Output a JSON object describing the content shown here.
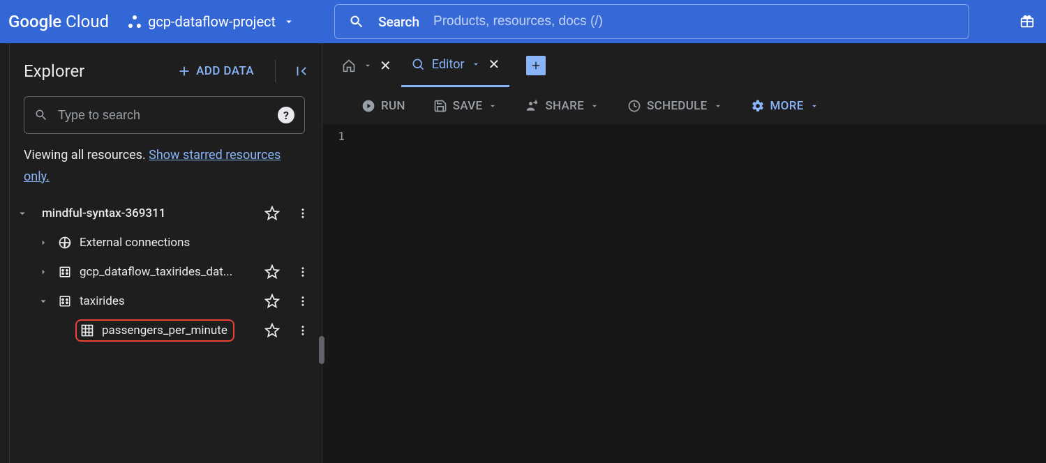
{
  "topbar": {
    "logo_bold": "Google",
    "logo_light": "Cloud",
    "project_name": "gcp-dataflow-project",
    "search_label": "Search",
    "search_placeholder": "Products, resources, docs (/)"
  },
  "explorer": {
    "title": "Explorer",
    "add_data_label": "ADD DATA",
    "search_placeholder": "Type to search",
    "viewing_text": "Viewing all resources. ",
    "show_starred_link": "Show starred resources only.",
    "tree": {
      "project": "mindful-syntax-369311",
      "external": "External connections",
      "dataset_truncated": "gcp_dataflow_taxirides_dat...",
      "dataset2": "taxirides",
      "table_highlighted": "passengers_per_minute"
    }
  },
  "tabs": {
    "editor_label": "Editor"
  },
  "toolbar": {
    "run": "RUN",
    "save": "SAVE",
    "share": "SHARE",
    "schedule": "SCHEDULE",
    "more": "MORE"
  },
  "editor": {
    "line_number": "1"
  }
}
